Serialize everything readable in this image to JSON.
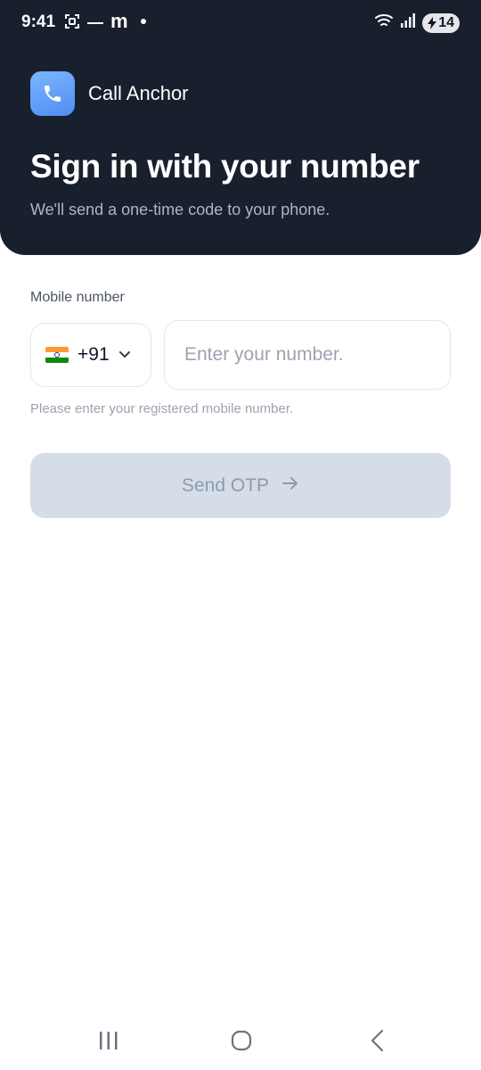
{
  "status_bar": {
    "time": "9:41",
    "m_logo": "m",
    "battery": "14"
  },
  "header": {
    "app_name": "Call Anchor",
    "title": "Sign in with your number",
    "subtitle": "We'll send a one-time code to your phone."
  },
  "form": {
    "mobile_label": "Mobile number",
    "country_code": "+91",
    "phone_value": "",
    "phone_placeholder": "Enter your number.",
    "hint": "Please enter your registered mobile number.",
    "send_button_label": "Send OTP",
    "send_button_enabled": false
  },
  "colors": {
    "header_bg": "#18202e",
    "brand_icon": "#5b9cf7",
    "button_disabled_bg": "#d5dee8",
    "button_disabled_text": "#8e9bad"
  },
  "icons": {
    "app": "phone-icon",
    "flag": "india-flag-icon",
    "dropdown": "chevron-down-icon",
    "send": "arrow-right-icon"
  }
}
